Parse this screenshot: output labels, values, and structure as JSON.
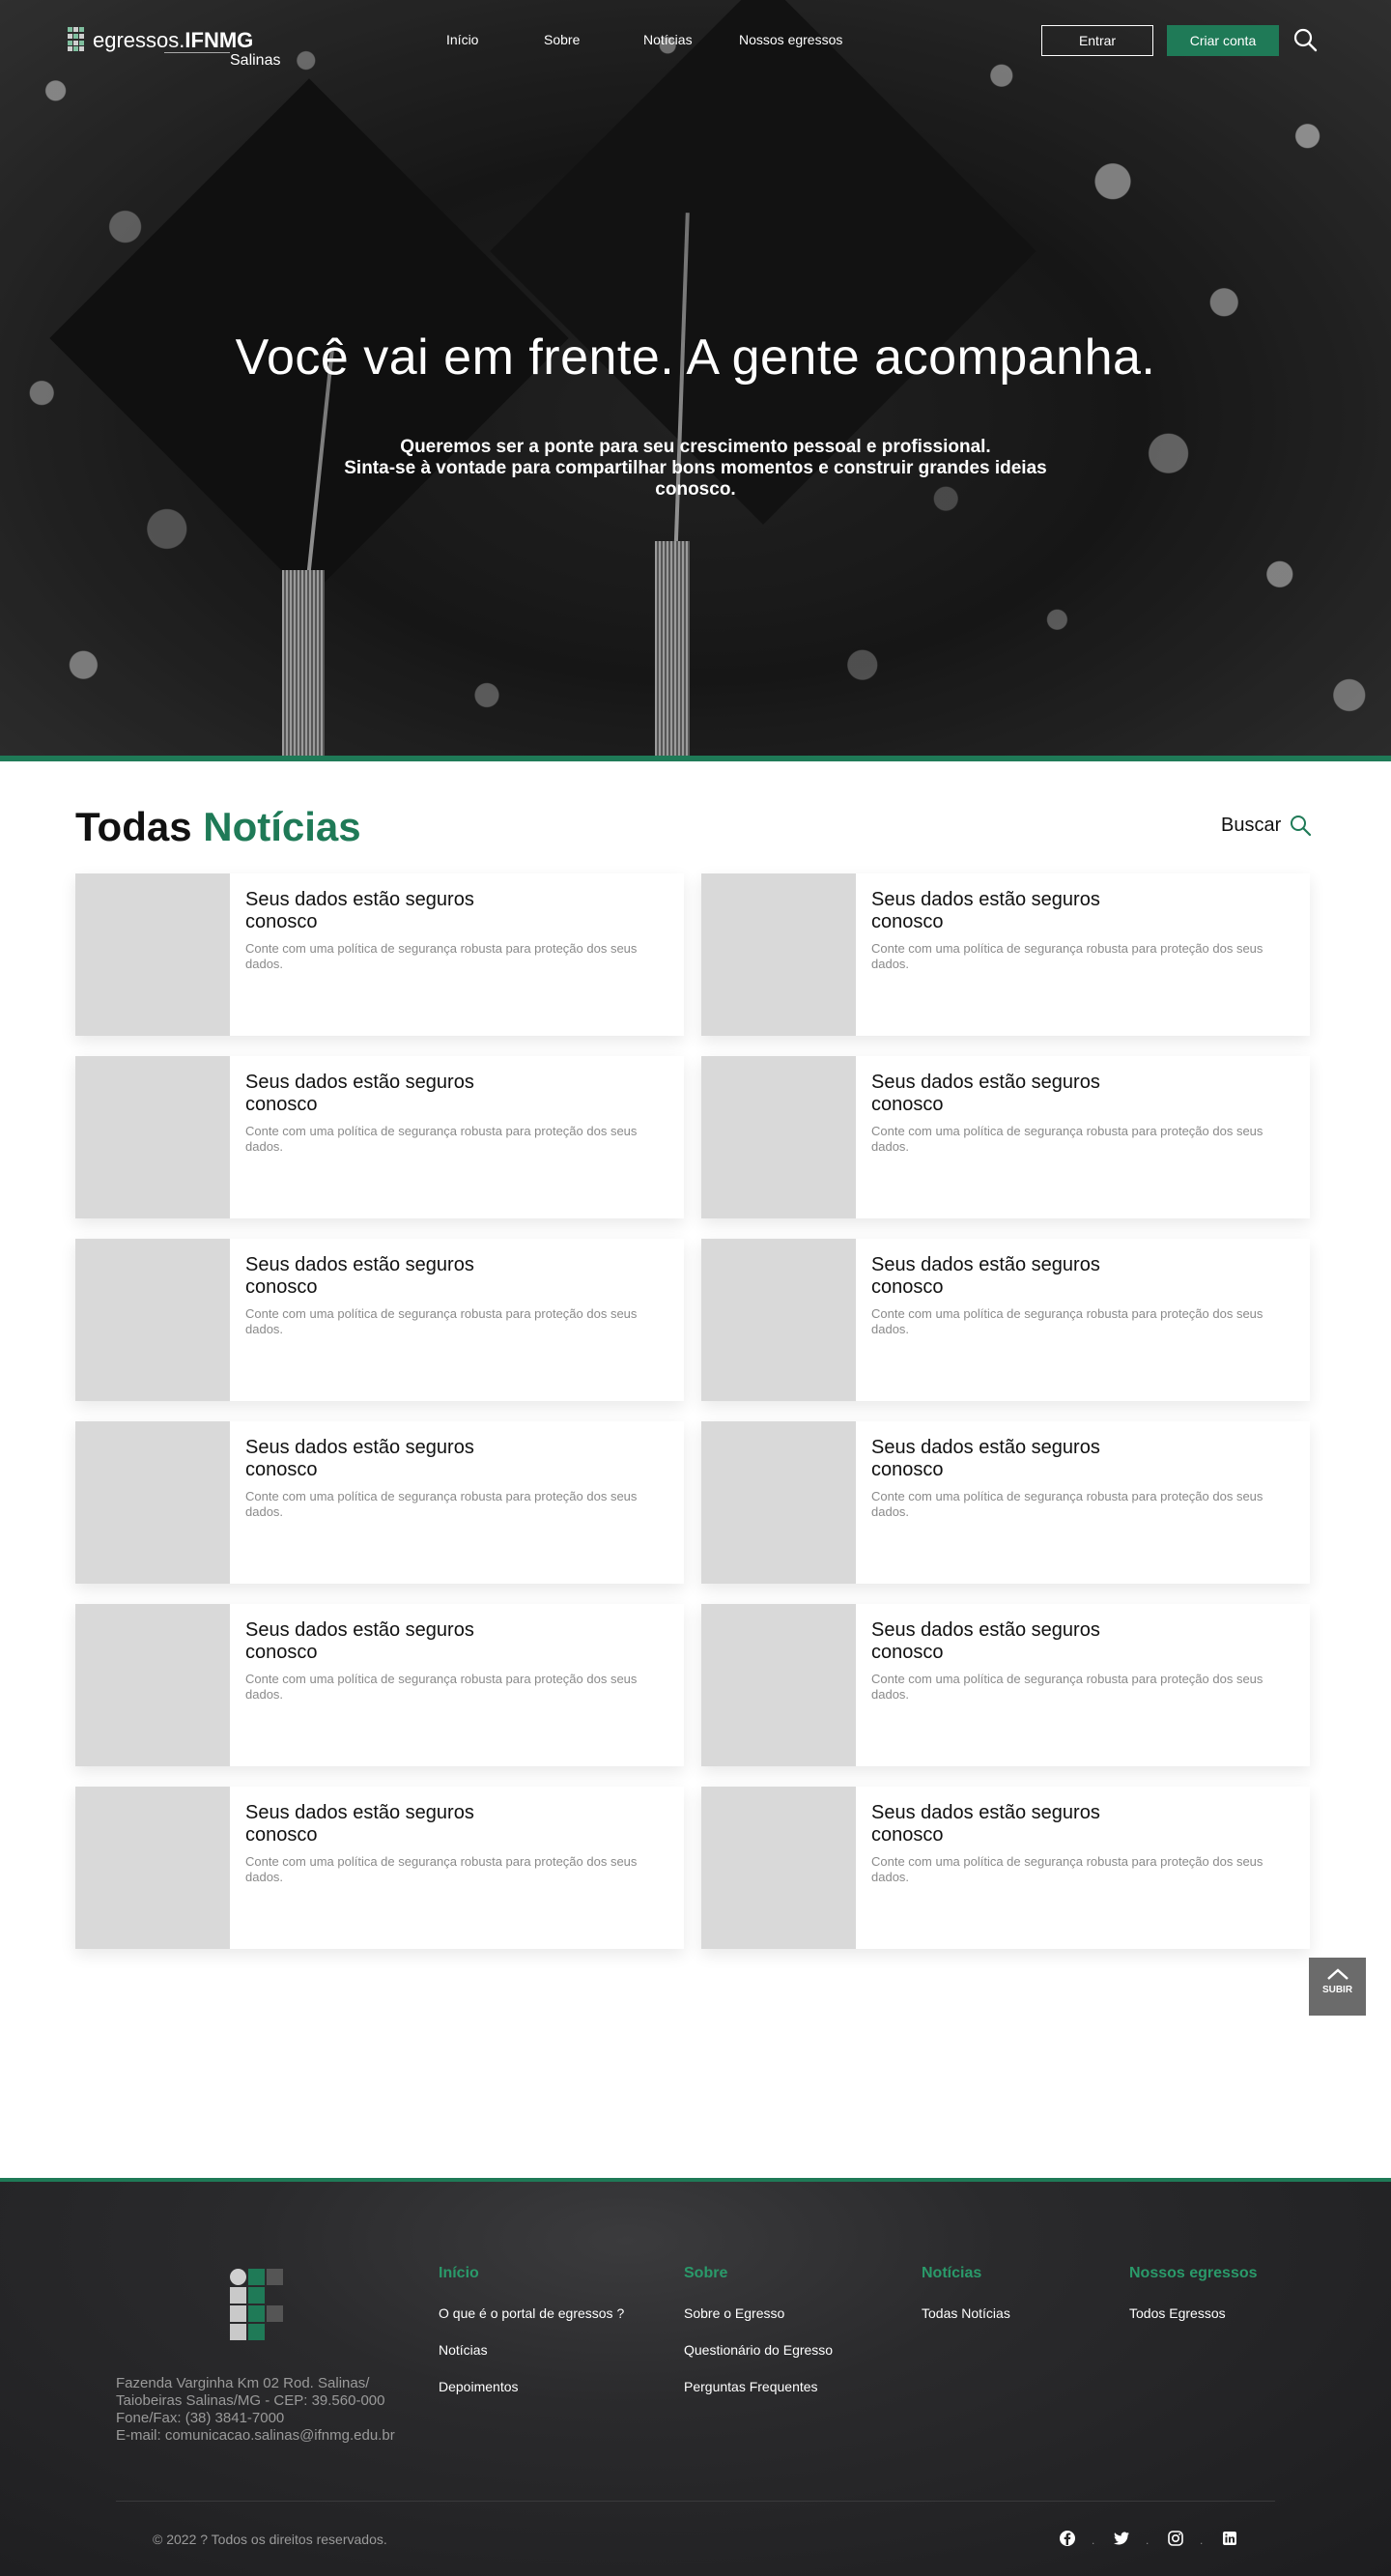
{
  "header": {
    "logo_main": "egressos.",
    "logo_bold": "IFNMG",
    "logo_sub": "Salinas",
    "nav": [
      "Início",
      "Sobre",
      "Notícias",
      "Nossos egressos"
    ],
    "login_label": "Entrar",
    "signup_label": "Criar conta"
  },
  "hero": {
    "title": "Você vai em frente. A gente acompanha.",
    "subtitle_line1": "Queremos ser a ponte para seu crescimento pessoal e profissional.",
    "subtitle_line2": "Sinta-se à vontade para compartilhar bons momentos e construir grandes ideias conosco."
  },
  "news": {
    "title_a": "Todas",
    "title_b": "Notícias",
    "search_label": "Buscar",
    "cards": [
      {
        "title": "Seus dados estão seguros conosco",
        "desc": "Conte com uma política de segurança robusta para proteção dos seus dados."
      },
      {
        "title": "Seus dados estão seguros conosco",
        "desc": "Conte com uma política de segurança robusta para proteção dos seus dados."
      },
      {
        "title": "Seus dados estão seguros conosco",
        "desc": "Conte com uma política de segurança robusta para proteção dos seus dados."
      },
      {
        "title": "Seus dados estão seguros conosco",
        "desc": "Conte com uma política de segurança robusta para proteção dos seus dados."
      },
      {
        "title": "Seus dados estão seguros conosco",
        "desc": "Conte com uma política de segurança robusta para proteção dos seus dados."
      },
      {
        "title": "Seus dados estão seguros conosco",
        "desc": "Conte com uma política de segurança robusta para proteção dos seus dados."
      },
      {
        "title": "Seus dados estão seguros conosco",
        "desc": "Conte com uma política de segurança robusta para proteção dos seus dados."
      },
      {
        "title": "Seus dados estão seguros conosco",
        "desc": "Conte com uma política de segurança robusta para proteção dos seus dados."
      },
      {
        "title": "Seus dados estão seguros conosco",
        "desc": "Conte com uma política de segurança robusta para proteção dos seus dados."
      },
      {
        "title": "Seus dados estão seguros conosco",
        "desc": "Conte com uma política de segurança robusta para proteção dos seus dados."
      },
      {
        "title": "Seus dados estão seguros conosco",
        "desc": "Conte com uma política de segurança robusta para proteção dos seus dados."
      },
      {
        "title": "Seus dados estão seguros conosco",
        "desc": "Conte com uma política de segurança robusta para proteção dos seus dados."
      }
    ]
  },
  "back_to_top_label": "SUBIR",
  "footer": {
    "address": [
      "Fazenda Varginha Km 02 Rod. Salinas/",
      "Taiobeiras Salinas/MG - CEP: 39.560-000",
      "Fone/Fax: (38) 3841-7000",
      "E-mail: comunicacao.salinas@ifnmg.edu.br"
    ],
    "columns": [
      {
        "heading": "Início",
        "links": [
          "O que é o portal de egressos ?",
          "Notícias",
          "Depoimentos"
        ]
      },
      {
        "heading": "Sobre",
        "links": [
          "Sobre o Egresso",
          "Questionário do Egresso",
          "Perguntas Frequentes"
        ]
      },
      {
        "heading": "Notícias",
        "links": [
          "Todas Notícias"
        ]
      },
      {
        "heading": "Nossos egressos",
        "links": [
          "Todos Egressos"
        ]
      }
    ],
    "copyright": "© 2022 ? Todos os direitos reservados.",
    "social": [
      "facebook-icon",
      "twitter-icon",
      "instagram-icon",
      "linkedin-icon"
    ]
  },
  "colors": {
    "accent": "#1f7a57",
    "footer_heading": "#2a9a6a"
  }
}
